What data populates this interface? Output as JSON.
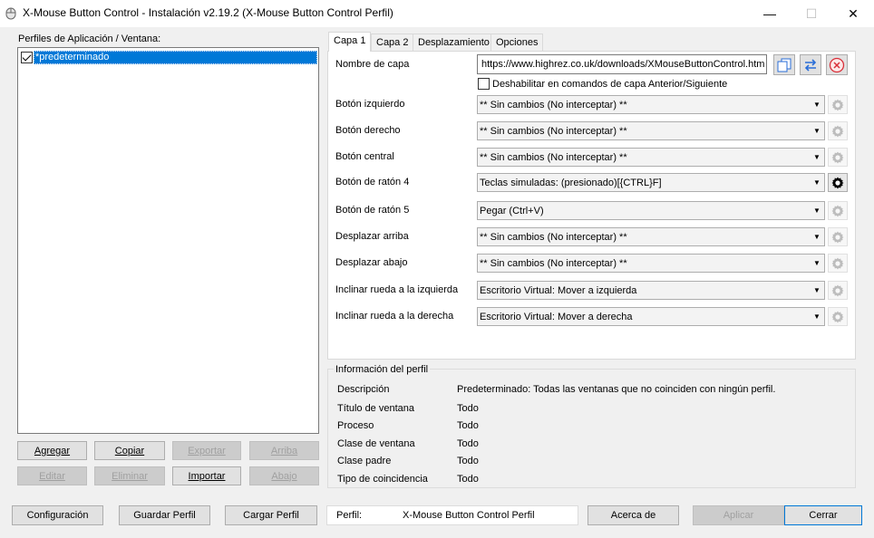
{
  "window": {
    "title": "X-Mouse Button Control - Instalación v2.19.2 (X-Mouse Button Control Perfil)",
    "minimize": "—",
    "maximize": "☐",
    "close": "✕"
  },
  "profiles": {
    "label": "Perfiles de Aplicación / Ventana:",
    "items": [
      {
        "label": "*predeterminado",
        "checked": true,
        "selected": true
      }
    ],
    "buttons": {
      "agregar": "Agregar",
      "copiar": "Copiar",
      "exportar": "Exportar",
      "arriba": "Arriba",
      "editar": "Editar",
      "eliminar": "Eliminar",
      "importar": "Importar",
      "abajo": "Abajo"
    }
  },
  "tabs": [
    "Capa 1",
    "Capa 2",
    "Desplazamiento",
    "Opciones"
  ],
  "layer": {
    "name_label": "Nombre de capa",
    "name_value": "https://www.highrez.co.uk/downloads/XMouseButtonControl.htm",
    "disable_label": "Deshabilitar en comandos de capa Anterior/Siguiente",
    "disable_checked": false,
    "rows": [
      {
        "label": "Botón izquierdo",
        "value": "** Sin cambios (No interceptar) **",
        "gear_active": false
      },
      {
        "label": "Botón derecho",
        "value": "** Sin cambios (No interceptar) **",
        "gear_active": false
      },
      {
        "label": "Botón central",
        "value": "** Sin cambios (No interceptar) **",
        "gear_active": false
      },
      {
        "label": "Botón de ratón 4",
        "value": "Teclas simuladas: (presionado)[{CTRL}F]",
        "gear_active": true
      },
      {
        "label": "Botón de ratón 5",
        "value": "Pegar (Ctrl+V)",
        "gear_active": false
      },
      {
        "label": "Desplazar arriba",
        "value": "** Sin cambios (No interceptar) **",
        "gear_active": false
      },
      {
        "label": "Desplazar abajo",
        "value": "** Sin cambios (No interceptar) **",
        "gear_active": false
      },
      {
        "label": "Inclinar rueda a la izquierda",
        "value": "Escritorio Virtual: Mover a izquierda",
        "gear_active": false
      },
      {
        "label": "Inclinar rueda a la derecha",
        "value": "Escritorio Virtual: Mover a derecha",
        "gear_active": false
      }
    ]
  },
  "profile_info": {
    "title": "Información del perfil",
    "rows": [
      {
        "label": "Descripción",
        "value": "Predeterminado: Todas las ventanas que no coinciden con ningún perfil."
      },
      {
        "label": "Título de ventana",
        "value": "Todo"
      },
      {
        "label": "Proceso",
        "value": "Todo"
      },
      {
        "label": "Clase de ventana",
        "value": "Todo"
      },
      {
        "label": "Clase padre",
        "value": "Todo"
      },
      {
        "label": "Tipo de coincidencia",
        "value": "Todo"
      }
    ]
  },
  "bottom": {
    "configuracion": "Configuración",
    "guardar": "Guardar Perfil",
    "cargar": "Cargar Perfil",
    "perfil_label": "Perfil:",
    "perfil_value": "X-Mouse Button Control Perfil",
    "acerca": "Acerca de",
    "aplicar": "Aplicar",
    "cerrar": "Cerrar"
  },
  "colors": {
    "selection": "#0078d7",
    "accent_blue": "#2a6ed8",
    "remove_red": "#d9303a"
  }
}
